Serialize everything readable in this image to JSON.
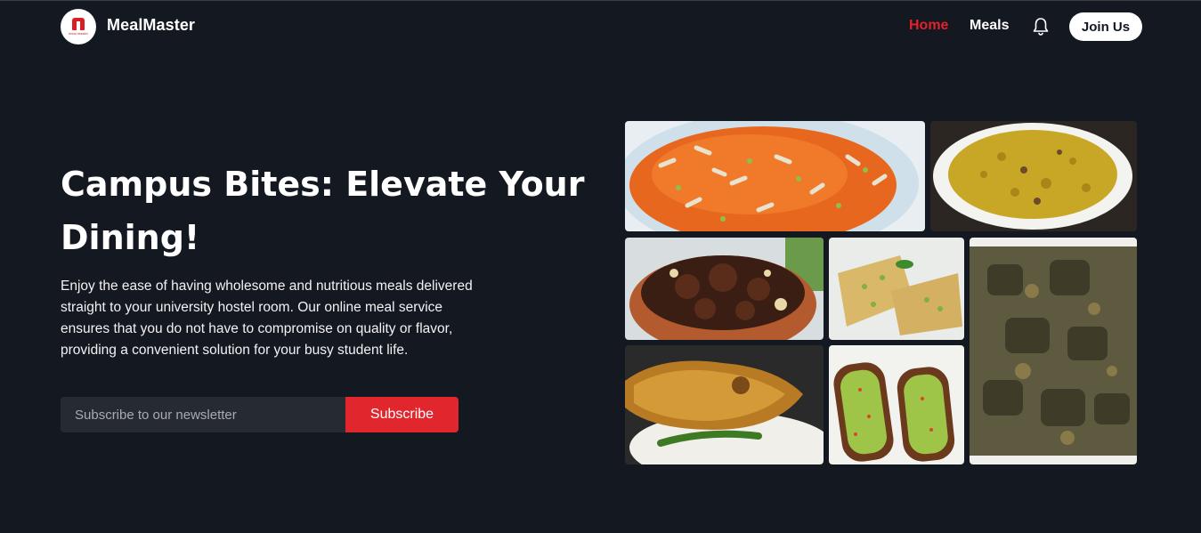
{
  "nav": {
    "logo_text": "meal master",
    "brand": "MealMaster",
    "links": [
      {
        "label": "Home",
        "active": true
      },
      {
        "label": "Meals",
        "active": false
      }
    ],
    "bell_icon": "bell-icon",
    "join_label": "Join Us"
  },
  "hero": {
    "title": "Campus Bites: Elevate Your Dining!",
    "description": "Enjoy the ease of having wholesome and nutritious meals delivered straight to your university hostel room. Our online meal service ensures that you do not have to compromise on quality or flavor, providing a convenient solution for your busy student life.",
    "newsletter": {
      "placeholder": "Subscribe to our newsletter",
      "value": "",
      "button_label": "Subscribe"
    }
  },
  "gallery": {
    "images": [
      {
        "name": "carrot-halwa-photo"
      },
      {
        "name": "yellow-pulao-photo"
      },
      {
        "name": "beef-bhuna-photo"
      },
      {
        "name": "suji-halwa-photo"
      },
      {
        "name": "mutton-curry-photo"
      },
      {
        "name": "fried-fish-rice-photo"
      },
      {
        "name": "avocado-toast-photo"
      }
    ]
  },
  "colors": {
    "background": "#141821",
    "accent": "#e1262d",
    "active_link": "#e4202a",
    "input_bg": "#262a32"
  }
}
